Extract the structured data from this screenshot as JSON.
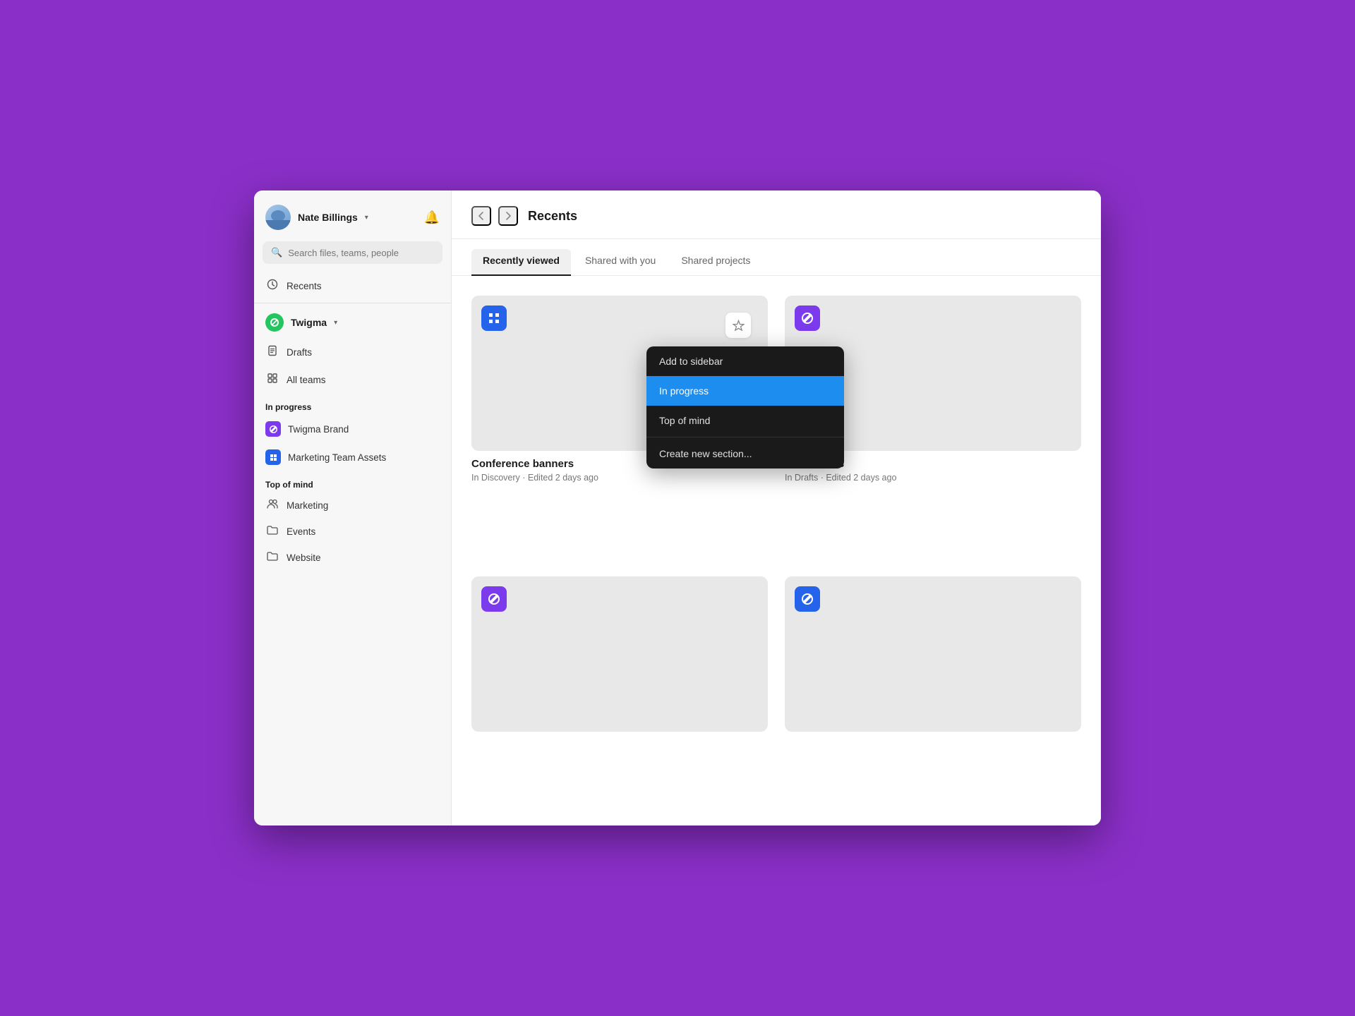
{
  "sidebar": {
    "user": {
      "name": "Nate Billings",
      "chevron": "▾"
    },
    "search": {
      "placeholder": "Search files, teams, people"
    },
    "nav": [
      {
        "id": "recents",
        "label": "Recents",
        "icon": "clock"
      }
    ],
    "workspace": {
      "name": "Twigma",
      "chevron": "▾"
    },
    "workspaceNav": [
      {
        "id": "drafts",
        "label": "Drafts",
        "icon": "doc"
      },
      {
        "id": "all-teams",
        "label": "All teams",
        "icon": "grid"
      }
    ],
    "sections": [
      {
        "label": "In progress",
        "items": [
          {
            "id": "twigma-brand",
            "label": "Twigma Brand",
            "color": "purple"
          },
          {
            "id": "marketing-assets",
            "label": "Marketing Team Assets",
            "color": "blue"
          }
        ]
      },
      {
        "label": "Top of mind",
        "items": [
          {
            "id": "marketing",
            "label": "Marketing",
            "icon": "people"
          },
          {
            "id": "events",
            "label": "Events",
            "icon": "folder"
          },
          {
            "id": "website",
            "label": "Website",
            "icon": "folder"
          }
        ]
      }
    ]
  },
  "header": {
    "title": "Recents"
  },
  "tabs": [
    {
      "id": "recently-viewed",
      "label": "Recently viewed",
      "active": true
    },
    {
      "id": "shared-with-you",
      "label": "Shared with you",
      "active": false
    },
    {
      "id": "shared-projects",
      "label": "Shared projects",
      "active": false
    }
  ],
  "cards": [
    {
      "id": "conference-banners",
      "title": "Conference banners",
      "meta": "In Discovery · Edited 2 days ago",
      "badge_color": "blue",
      "show_star": true,
      "show_dropdown": true
    },
    {
      "id": "banner-riffs",
      "title": "Banner riffs",
      "meta": "In Drafts · Edited 2 days ago",
      "badge_color": "purple",
      "show_star": false,
      "show_dropdown": false
    },
    {
      "id": "card-3",
      "title": "",
      "meta": "",
      "badge_color": "purple",
      "show_star": false,
      "show_dropdown": false
    },
    {
      "id": "card-4",
      "title": "",
      "meta": "",
      "badge_color": "blue",
      "show_star": false,
      "show_dropdown": false
    }
  ],
  "dropdown": {
    "add_to_sidebar": "Add to sidebar",
    "in_progress": "In progress",
    "top_of_mind": "Top of mind",
    "create_new_section": "Create new section..."
  }
}
